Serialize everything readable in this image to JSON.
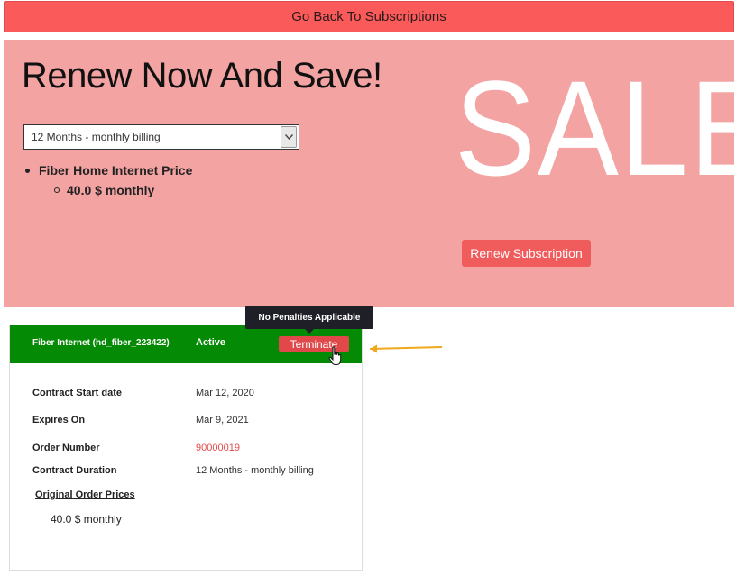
{
  "header": {
    "back_label": "Go Back To Subscriptions"
  },
  "promo": {
    "title": "Renew Now And Save!",
    "sale_text": "SALE",
    "billing_select": {
      "selected": "12 Months - monthly billing"
    },
    "price_item": "Fiber Home Internet Price",
    "price_value": "40.0 $ monthly",
    "renew_label": "Renew Subscription"
  },
  "subscription": {
    "name": "Fiber Internet (hd_fiber_223422)",
    "status": "Active",
    "terminate_label": "Terminate",
    "tooltip": "No Penalties Applicable",
    "details": [
      {
        "label": "Contract Start date",
        "value": "Mar 12, 2020"
      },
      {
        "label": "Expires On",
        "value": "Mar 9, 2021"
      },
      {
        "label": "Order Number",
        "value": "90000019"
      },
      {
        "label": "Contract Duration",
        "value": "12 Months - monthly billing"
      }
    ],
    "original_prices_label": "Original Order Prices",
    "original_price": "40.0 $ monthly"
  },
  "colors": {
    "back_button": "#fa5a59",
    "promo_bg": "#f4a3a3",
    "card_header": "#058a05",
    "terminate": "#e0484a",
    "order_number": "#e24a4a",
    "annotation_arrow": "#f0a81c"
  },
  "icons": {
    "select_arrow": "chevron-down-icon",
    "cursor": "hand-pointer-icon",
    "annotation": "arrow-left-icon"
  }
}
